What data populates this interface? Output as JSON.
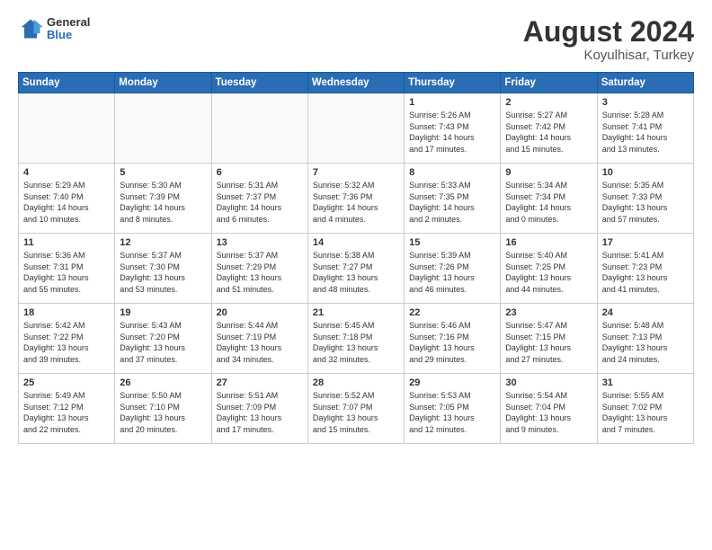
{
  "header": {
    "logo_general": "General",
    "logo_blue": "Blue",
    "month_title": "August 2024",
    "location": "Koyulhisar, Turkey"
  },
  "weekdays": [
    "Sunday",
    "Monday",
    "Tuesday",
    "Wednesday",
    "Thursday",
    "Friday",
    "Saturday"
  ],
  "weeks": [
    [
      {
        "day": "",
        "text": ""
      },
      {
        "day": "",
        "text": ""
      },
      {
        "day": "",
        "text": ""
      },
      {
        "day": "",
        "text": ""
      },
      {
        "day": "1",
        "text": "Sunrise: 5:26 AM\nSunset: 7:43 PM\nDaylight: 14 hours\nand 17 minutes."
      },
      {
        "day": "2",
        "text": "Sunrise: 5:27 AM\nSunset: 7:42 PM\nDaylight: 14 hours\nand 15 minutes."
      },
      {
        "day": "3",
        "text": "Sunrise: 5:28 AM\nSunset: 7:41 PM\nDaylight: 14 hours\nand 13 minutes."
      }
    ],
    [
      {
        "day": "4",
        "text": "Sunrise: 5:29 AM\nSunset: 7:40 PM\nDaylight: 14 hours\nand 10 minutes."
      },
      {
        "day": "5",
        "text": "Sunrise: 5:30 AM\nSunset: 7:39 PM\nDaylight: 14 hours\nand 8 minutes."
      },
      {
        "day": "6",
        "text": "Sunrise: 5:31 AM\nSunset: 7:37 PM\nDaylight: 14 hours\nand 6 minutes."
      },
      {
        "day": "7",
        "text": "Sunrise: 5:32 AM\nSunset: 7:36 PM\nDaylight: 14 hours\nand 4 minutes."
      },
      {
        "day": "8",
        "text": "Sunrise: 5:33 AM\nSunset: 7:35 PM\nDaylight: 14 hours\nand 2 minutes."
      },
      {
        "day": "9",
        "text": "Sunrise: 5:34 AM\nSunset: 7:34 PM\nDaylight: 14 hours\nand 0 minutes."
      },
      {
        "day": "10",
        "text": "Sunrise: 5:35 AM\nSunset: 7:33 PM\nDaylight: 13 hours\nand 57 minutes."
      }
    ],
    [
      {
        "day": "11",
        "text": "Sunrise: 5:36 AM\nSunset: 7:31 PM\nDaylight: 13 hours\nand 55 minutes."
      },
      {
        "day": "12",
        "text": "Sunrise: 5:37 AM\nSunset: 7:30 PM\nDaylight: 13 hours\nand 53 minutes."
      },
      {
        "day": "13",
        "text": "Sunrise: 5:37 AM\nSunset: 7:29 PM\nDaylight: 13 hours\nand 51 minutes."
      },
      {
        "day": "14",
        "text": "Sunrise: 5:38 AM\nSunset: 7:27 PM\nDaylight: 13 hours\nand 48 minutes."
      },
      {
        "day": "15",
        "text": "Sunrise: 5:39 AM\nSunset: 7:26 PM\nDaylight: 13 hours\nand 46 minutes."
      },
      {
        "day": "16",
        "text": "Sunrise: 5:40 AM\nSunset: 7:25 PM\nDaylight: 13 hours\nand 44 minutes."
      },
      {
        "day": "17",
        "text": "Sunrise: 5:41 AM\nSunset: 7:23 PM\nDaylight: 13 hours\nand 41 minutes."
      }
    ],
    [
      {
        "day": "18",
        "text": "Sunrise: 5:42 AM\nSunset: 7:22 PM\nDaylight: 13 hours\nand 39 minutes."
      },
      {
        "day": "19",
        "text": "Sunrise: 5:43 AM\nSunset: 7:20 PM\nDaylight: 13 hours\nand 37 minutes."
      },
      {
        "day": "20",
        "text": "Sunrise: 5:44 AM\nSunset: 7:19 PM\nDaylight: 13 hours\nand 34 minutes."
      },
      {
        "day": "21",
        "text": "Sunrise: 5:45 AM\nSunset: 7:18 PM\nDaylight: 13 hours\nand 32 minutes."
      },
      {
        "day": "22",
        "text": "Sunrise: 5:46 AM\nSunset: 7:16 PM\nDaylight: 13 hours\nand 29 minutes."
      },
      {
        "day": "23",
        "text": "Sunrise: 5:47 AM\nSunset: 7:15 PM\nDaylight: 13 hours\nand 27 minutes."
      },
      {
        "day": "24",
        "text": "Sunrise: 5:48 AM\nSunset: 7:13 PM\nDaylight: 13 hours\nand 24 minutes."
      }
    ],
    [
      {
        "day": "25",
        "text": "Sunrise: 5:49 AM\nSunset: 7:12 PM\nDaylight: 13 hours\nand 22 minutes."
      },
      {
        "day": "26",
        "text": "Sunrise: 5:50 AM\nSunset: 7:10 PM\nDaylight: 13 hours\nand 20 minutes."
      },
      {
        "day": "27",
        "text": "Sunrise: 5:51 AM\nSunset: 7:09 PM\nDaylight: 13 hours\nand 17 minutes."
      },
      {
        "day": "28",
        "text": "Sunrise: 5:52 AM\nSunset: 7:07 PM\nDaylight: 13 hours\nand 15 minutes."
      },
      {
        "day": "29",
        "text": "Sunrise: 5:53 AM\nSunset: 7:05 PM\nDaylight: 13 hours\nand 12 minutes."
      },
      {
        "day": "30",
        "text": "Sunrise: 5:54 AM\nSunset: 7:04 PM\nDaylight: 13 hours\nand 9 minutes."
      },
      {
        "day": "31",
        "text": "Sunrise: 5:55 AM\nSunset: 7:02 PM\nDaylight: 13 hours\nand 7 minutes."
      }
    ]
  ]
}
